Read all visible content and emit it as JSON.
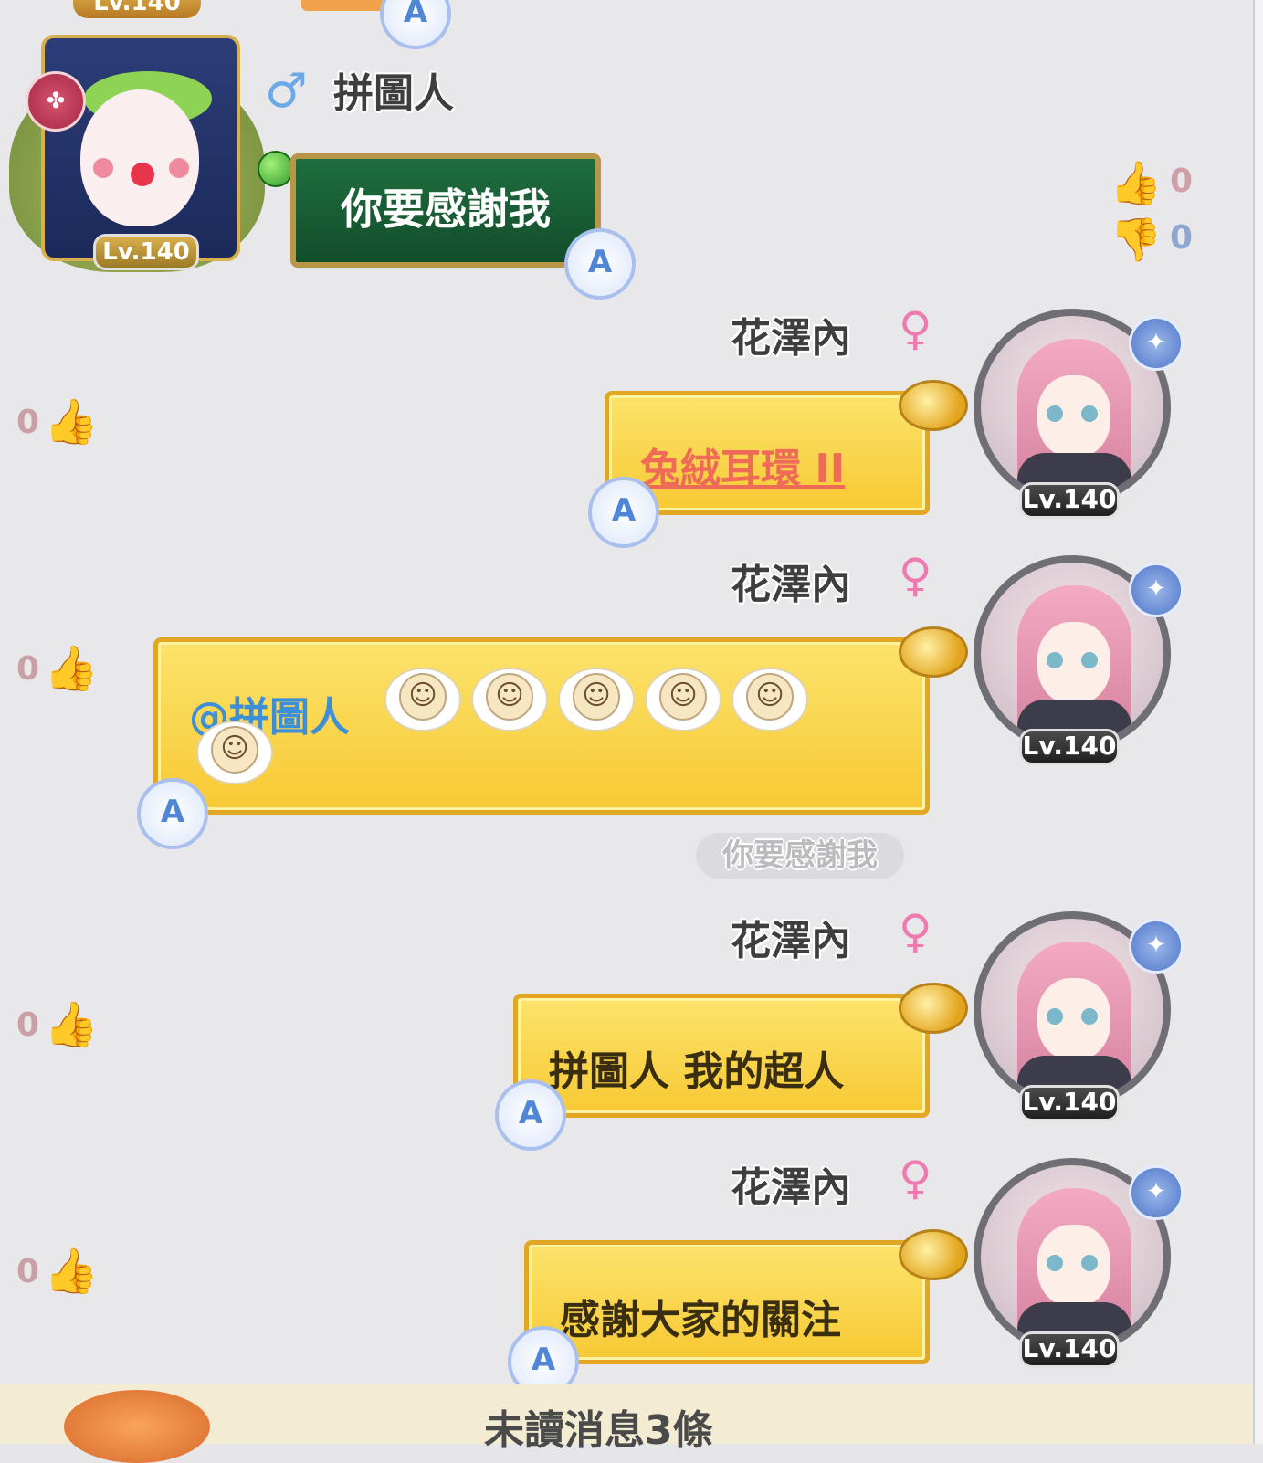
{
  "messages": [
    {
      "sender": "拼圖人",
      "gender_symbol": "♂",
      "level": "Lv.140",
      "text": "你要感謝我",
      "likes": "0",
      "dislikes": "0"
    },
    {
      "sender": "花澤內",
      "gender_symbol": "♀",
      "level": "Lv.140",
      "text": "兔絨耳環 II",
      "likes": "0"
    },
    {
      "sender": "花澤內",
      "gender_symbol": "♀",
      "level": "Lv.140",
      "mention": "@拼圖人",
      "emoji_count": 6,
      "quote": "你要感謝我",
      "likes": "0"
    },
    {
      "sender": "花澤內",
      "gender_symbol": "♀",
      "level": "Lv.140",
      "text": "拼圖人 我的超人",
      "likes": "0"
    },
    {
      "sender": "花澤內",
      "gender_symbol": "♀",
      "level": "Lv.140",
      "text": "感謝大家的關注",
      "likes": "0"
    }
  ],
  "top_partial_level": "Lv.140",
  "translate_label": "A",
  "unread_text": "未讀消息3條",
  "icons": {
    "like": "thumbs-up-icon",
    "dislike": "thumbs-down-icon",
    "translate": "translate-icon",
    "guild": "guild-badge-icon",
    "emblem": "rank-emblem-icon"
  },
  "colors": {
    "link_item": "#ef6b58",
    "mention": "#3d8fd8",
    "male": "#6aa8e8",
    "female": "#ee7ab0"
  }
}
